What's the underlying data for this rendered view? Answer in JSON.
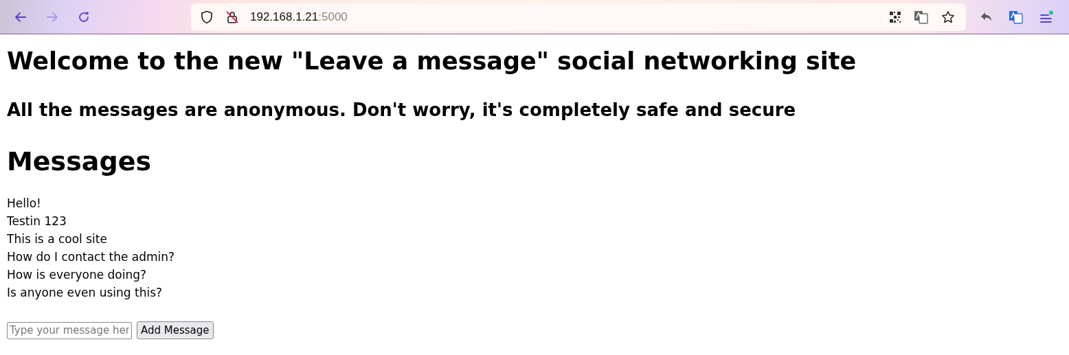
{
  "browser": {
    "url_host": "192.168.1.21",
    "url_port": ":5000",
    "back_disabled": false,
    "forward_disabled": true,
    "menu_notification": true
  },
  "page": {
    "title": "Welcome to the new \"Leave a message\" social networking site",
    "subtitle": "All the messages are anonymous. Don't worry, it's completely safe and secure",
    "messages_heading": "Messages",
    "messages": [
      "Hello!",
      "Testin 123",
      "This is a cool site",
      "How do I contact the admin?",
      "How is everyone doing?",
      "Is anyone even using this?"
    ],
    "message_input": {
      "placeholder": "Type your message her"
    },
    "add_button": "Add Message"
  }
}
